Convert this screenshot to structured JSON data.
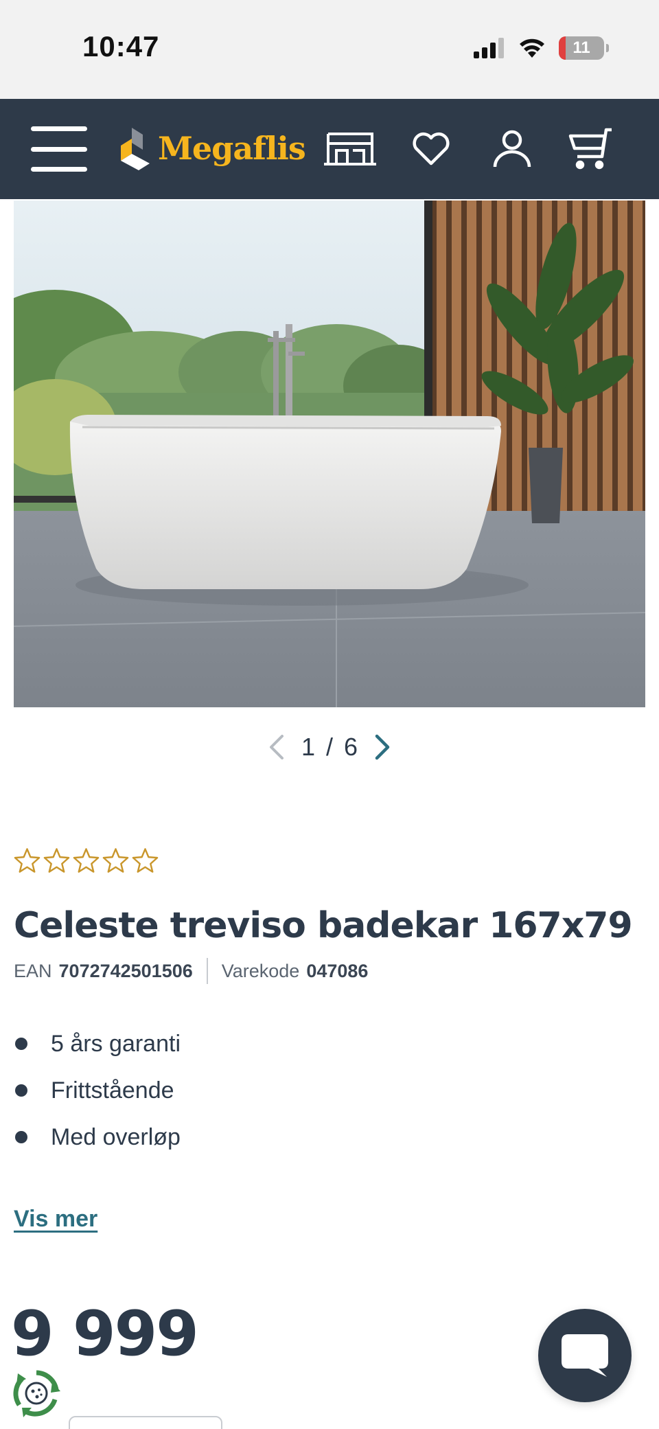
{
  "status_bar": {
    "time": "10:47",
    "battery_level": "11"
  },
  "header": {
    "logo_text": "Megaflis",
    "background_color": "#2e3a49",
    "accent_color": "#f6b51e",
    "icons": [
      "hamburger-menu-icon",
      "store-icon",
      "heart-icon",
      "user-icon",
      "cart-icon"
    ]
  },
  "gallery": {
    "current": "1",
    "separator": "/",
    "total": "6"
  },
  "product": {
    "rating_stars": 0,
    "rating_max": 5,
    "title": "Celeste treviso badekar 167x79",
    "ean_label": "EAN",
    "ean_value": "7072742501506",
    "varekode_label": "Varekode",
    "varekode_value": "047086",
    "features": [
      "5 års garanti",
      "Frittstående",
      "Med overløp"
    ],
    "show_more": "Vis mer",
    "price": "9 999"
  },
  "colors": {
    "text_dark": "#2d3a4a",
    "link": "#2c6e80",
    "star_outline": "#c9962b"
  }
}
